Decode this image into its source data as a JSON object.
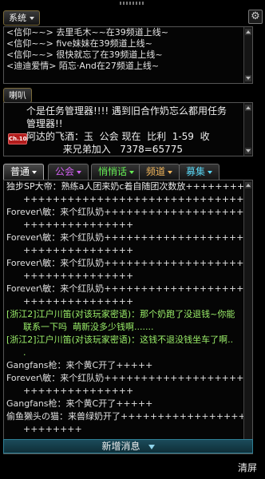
{
  "system_menu": {
    "label": "系统"
  },
  "horn_menu": {
    "label": "喇叭"
  },
  "system_log": [
    "<信仰~~> 去里毛木~~在39频道上线~",
    "<信仰~~> five妹妹在39频道上线~",
    "<信仰~~> 很快就忘了在39频道上线~",
    "<迪迪爱情> 陌忘·And在27频道上线~"
  ],
  "horn": {
    "badge": "Ch.10",
    "lines": [
      "个是任务管理器!!!! 遇到旧合作奶忘么都用任务",
      "管理器!!",
      "阿达的飞酒：玉  公会 现在  比利  1-59  收",
      "            来兄弟加入   7378=65775"
    ]
  },
  "tabs": [
    {
      "label": "普通",
      "color": "#ffffff",
      "caret": true
    },
    {
      "label": "公会",
      "color": "#d060f0",
      "caret": true
    },
    {
      "label": "悄悄话",
      "color": "#66ee55",
      "caret": true
    },
    {
      "label": "频道",
      "color": "#f0b45a",
      "caret": true
    },
    {
      "label": "募集",
      "color": "#58d2f0",
      "caret": true
    }
  ],
  "chat": [
    {
      "text": "独步SP大帝：熟练a人团来奶c着自随团次数放+++++++++",
      "color": "#e8e8e8"
    },
    {
      "text": "      +++++++++++++++++++++++++++++++++7=1来奶",
      "color": "#e8e8e8"
    },
    {
      "text": "Forever\\敏：来个红队奶++++++++++++++++++++++++++++",
      "color": "#e0e0e0"
    },
    {
      "text": "      +++++++++++++++",
      "color": "#e0e0e0"
    },
    {
      "text": "Forever\\敏：来个红队奶++++++++++++++++++++++++++++",
      "color": "#e0e0e0"
    },
    {
      "text": "      +++++++++++++++",
      "color": "#e0e0e0"
    },
    {
      "text": "Forever\\敏：来个红队奶++++++++++++++++++++++++++++",
      "color": "#e0e0e0"
    },
    {
      "text": "      +++++++++++++++",
      "color": "#e0e0e0"
    },
    {
      "text": "Forever\\敏：来个红队奶++++++++++++++++++++++++++++",
      "color": "#e0e0e0"
    },
    {
      "text": "      +++++++++++++++",
      "color": "#e0e0e0"
    },
    {
      "text": "[浙江2]江户川笛(对该玩家密语)：那个奶跑了没退钱~你能",
      "color": "#9cf06a"
    },
    {
      "text": "      联系一下吗  萌新没多少钱啊.......",
      "color": "#9cf06a"
    },
    {
      "text": "[浙江2]江户川笛(对该玩家密语)：这钱不退没钱坐车了啊..",
      "color": "#9cf06a"
    },
    {
      "text": "      .",
      "color": "#9cf06a"
    },
    {
      "text": "Gangfans枪：来个黄C开了+++++",
      "color": "#e0e0e0"
    },
    {
      "text": "Forever\\敏：来个红队奶++++++++++++++++++++++++++++",
      "color": "#e0e0e0"
    },
    {
      "text": "      +++++++++++++++",
      "color": "#e0e0e0"
    },
    {
      "text": "Gangfans枪：来个黄C开了+++++",
      "color": "#e0e0e0"
    },
    {
      "text": "偷鱼獭头の猫：来兽绿奶开了+++++++++++++++++++++",
      "color": "#e0e0e0"
    },
    {
      "text": "      ++++++++",
      "color": "#e0e0e0"
    }
  ],
  "new_message": "新增消息",
  "clear_screen": "清屏"
}
